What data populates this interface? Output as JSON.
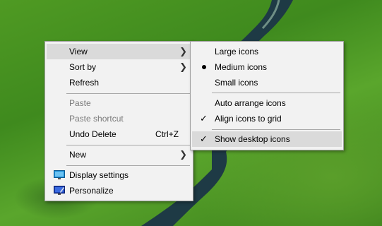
{
  "main_menu": {
    "view": "View",
    "sort_by": "Sort by",
    "refresh": "Refresh",
    "paste": "Paste",
    "paste_shortcut": "Paste shortcut",
    "undo_delete": "Undo Delete",
    "undo_delete_shortcut": "Ctrl+Z",
    "new": "New",
    "display_settings": "Display settings",
    "personalize": "Personalize",
    "submenu_arrow": "chevron-right-icon"
  },
  "view_submenu": {
    "large_icons": "Large icons",
    "medium_icons": "Medium icons",
    "small_icons": "Small icons",
    "auto_arrange": "Auto arrange icons",
    "align_to_grid": "Align icons to grid",
    "show_desktop_icons": "Show desktop icons",
    "selected_size": "Medium icons",
    "checked": [
      "Align icons to grid",
      "Show desktop icons"
    ]
  },
  "colors": {
    "menu_bg": "#f2f2f2",
    "highlight": "#dadada",
    "disabled_text": "#7a7a7a",
    "grass": "#4f9a23",
    "river": "#1e3a45"
  }
}
